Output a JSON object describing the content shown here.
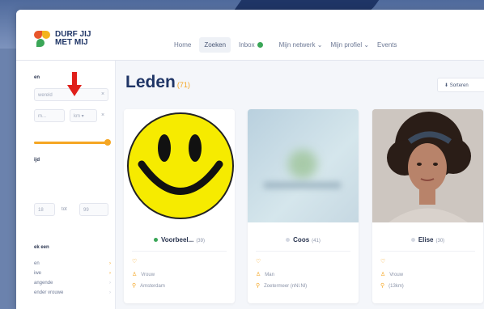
{
  "brand": {
    "line1": "DURF JIJ",
    "line2": "MET MIJ"
  },
  "nav": {
    "items": [
      {
        "label": "Home"
      },
      {
        "label": "Zoeken",
        "active": true
      },
      {
        "label": "Inbox"
      },
      {
        "label": "Mijn netwerk ⌄"
      },
      {
        "label": "Mijn profiel ⌄"
      },
      {
        "label": "Events"
      }
    ],
    "inbox_status_color": "#3aa657"
  },
  "page": {
    "title": "Leden",
    "count": "(71)",
    "sort_label": "⬇ Sorteren"
  },
  "sidebar": {
    "heading_search": "en",
    "search_placeholder": "wereld",
    "from_placeholder": "m...",
    "unit_value": "km ▾",
    "clear_symbol": "×",
    "heading_age": "ijd",
    "age_from": "18",
    "age_sep": "tot",
    "age_to": "99",
    "heading_looking": "ek een",
    "options": [
      "en",
      "iwe",
      "angende",
      "ender vrouwe"
    ]
  },
  "members": [
    {
      "name": "Voorbeel...",
      "age": "(39)",
      "online": true,
      "gender": "Vrouw",
      "location": "Amsterdam",
      "photo": "smiley-icon"
    },
    {
      "name": "Coos",
      "age": "(41)",
      "online": false,
      "gender": "Man",
      "location": "Zoetermeer (nNl.Nl)",
      "photo": "blurred-photo"
    },
    {
      "name": "Elise",
      "age": "(30)",
      "online": false,
      "gender": "Vrouw",
      "location": "(13km)",
      "photo": "woman-portrait"
    }
  ],
  "colors": {
    "brand": "#1f3566",
    "accent": "#f5a623",
    "arrow": "#e0201b"
  }
}
